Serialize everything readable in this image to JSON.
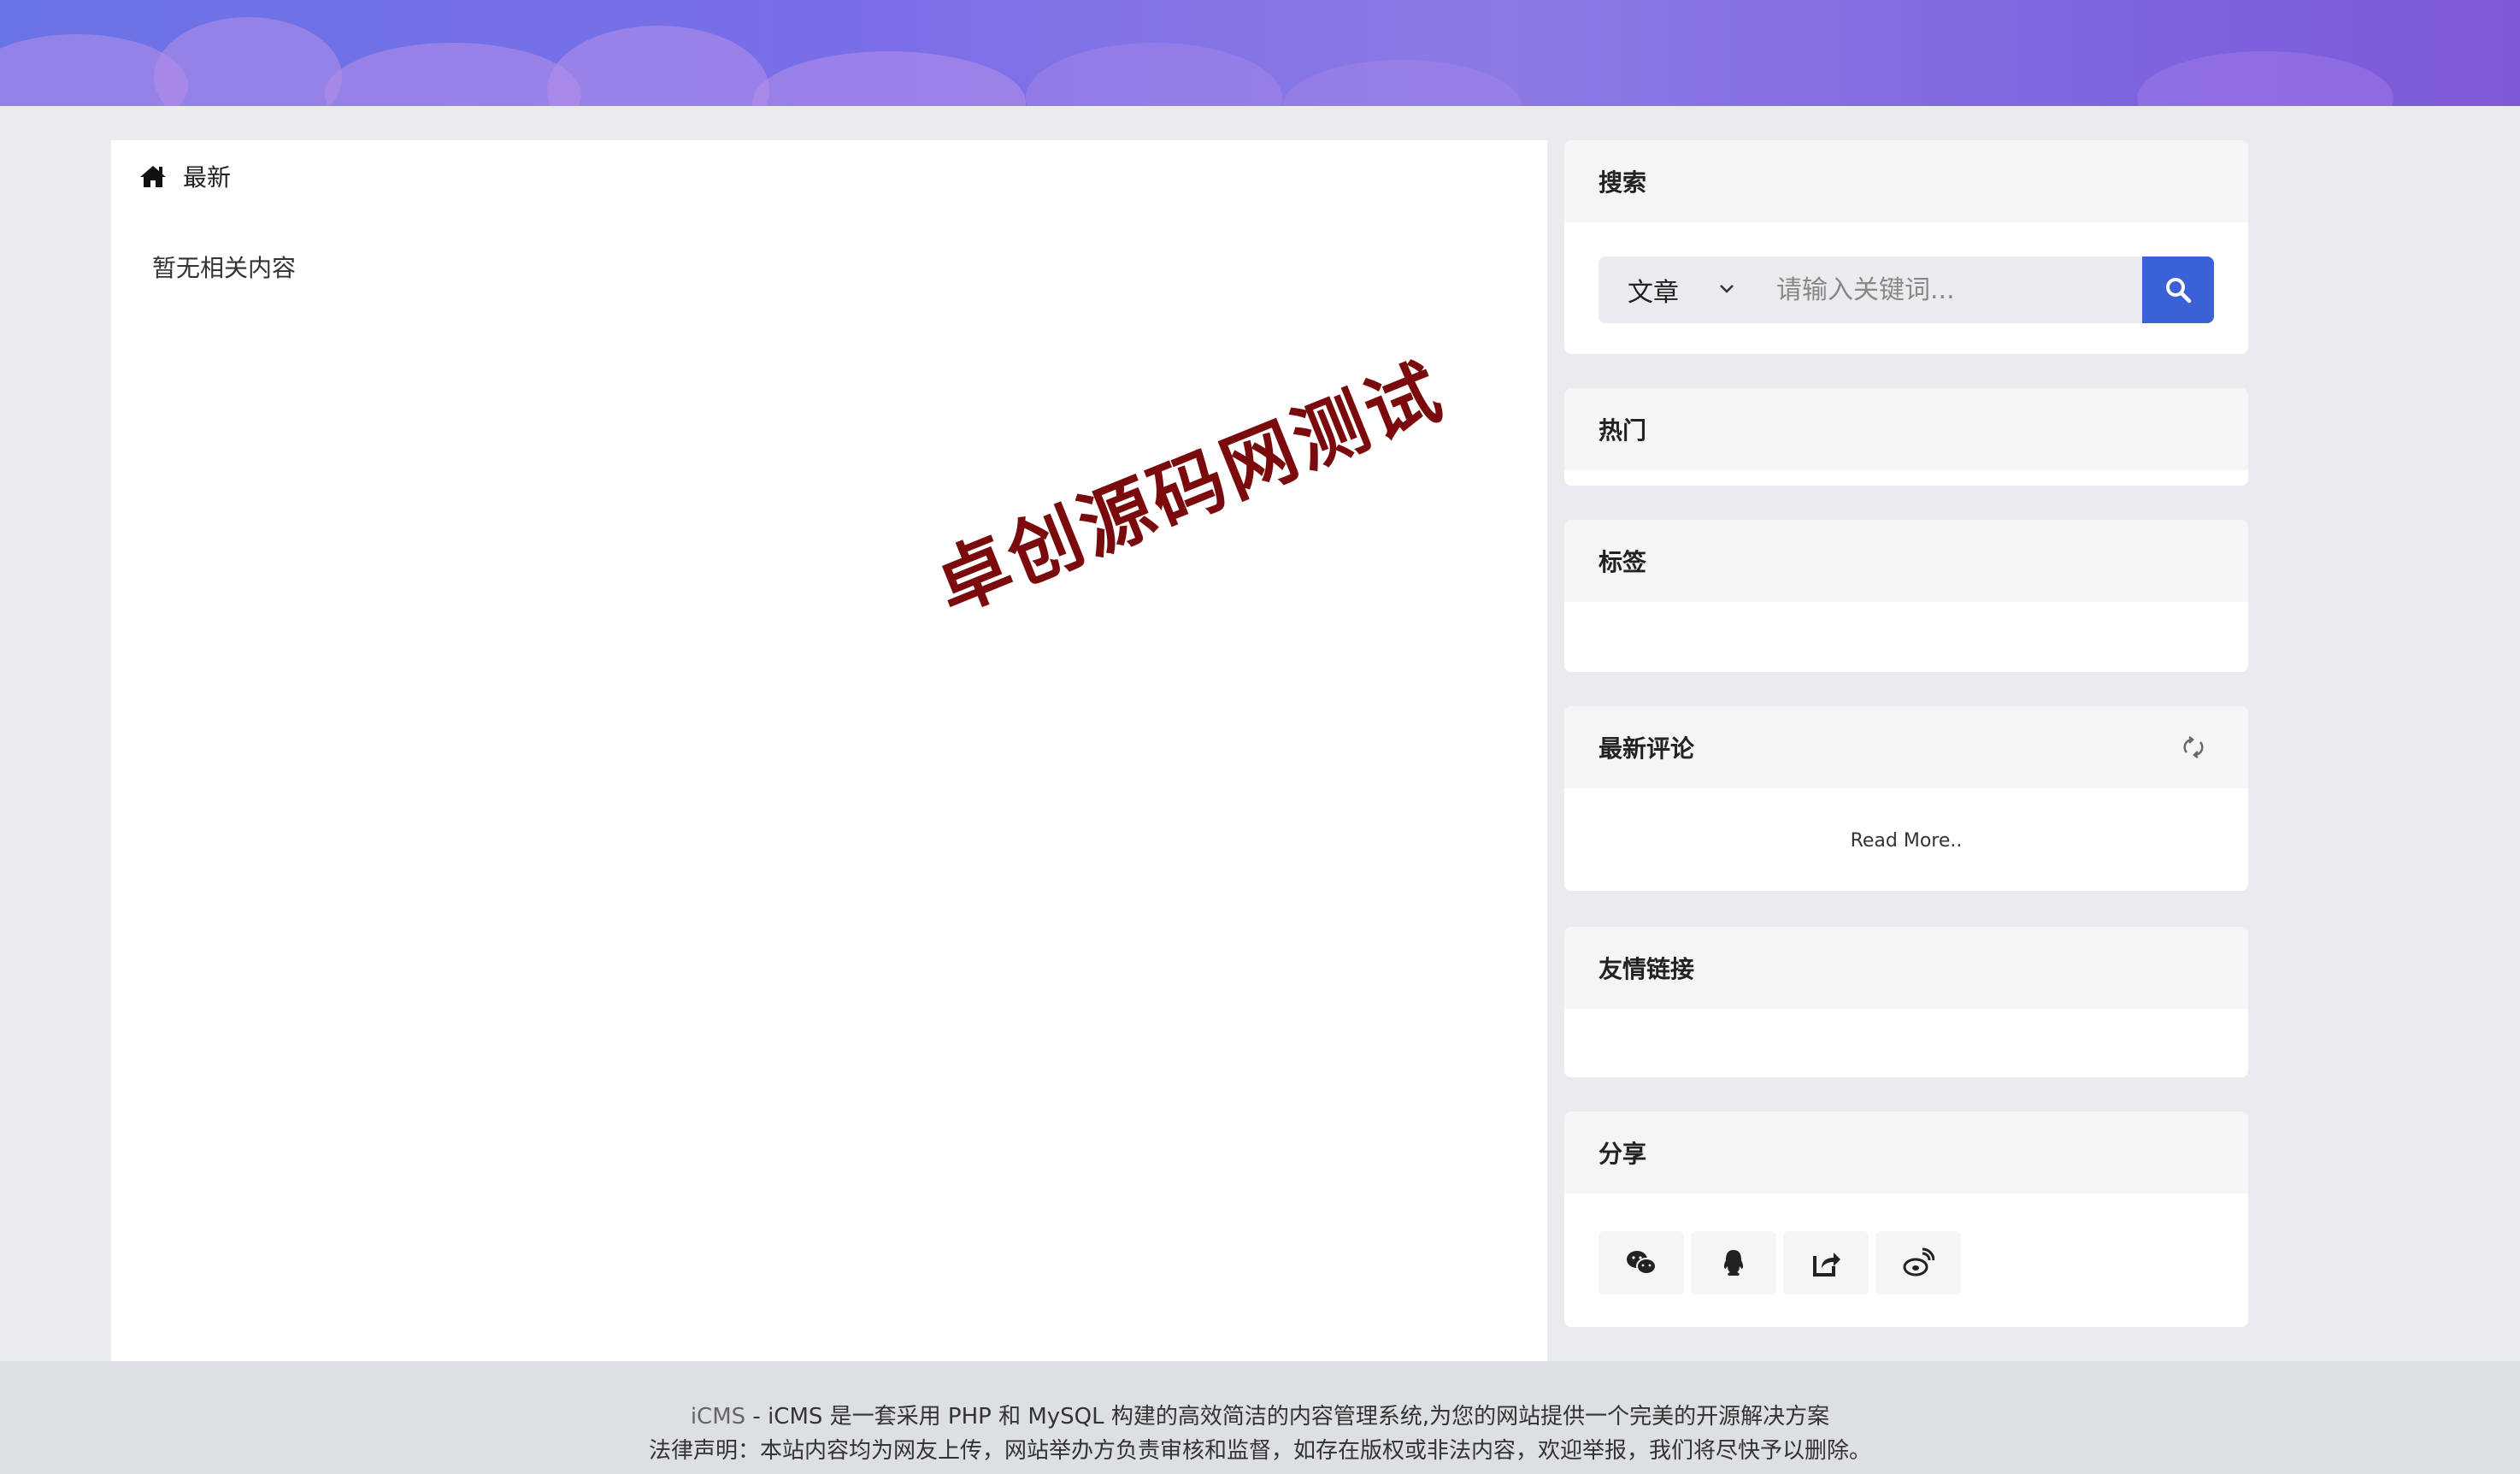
{
  "breadcrumb": {
    "label": "最新"
  },
  "main": {
    "empty_text": "暂无相关内容"
  },
  "watermark": "卓创源码网测试",
  "search": {
    "title": "搜索",
    "type_selected": "文章",
    "placeholder": "请输入关键词..."
  },
  "hot": {
    "title": "热门"
  },
  "tags": {
    "title": "标签"
  },
  "comments": {
    "title": "最新评论",
    "read_more": "Read More.."
  },
  "links": {
    "title": "友情链接"
  },
  "share": {
    "title": "分享",
    "icons": [
      "wechat-icon",
      "qq-icon",
      "share-icon",
      "weibo-icon"
    ]
  },
  "footer": {
    "brand": "iCMS",
    "tagline": " - iCMS 是一套采用 PHP 和 MySQL 构建的高效简洁的内容管理系统,为您的网站提供一个完美的开源解决方案",
    "legal": "法律声明：本站内容均为网友上传，网站举办方负责审核和监督，如存在版权或非法内容，欢迎举报，我们将尽快予以删除。"
  },
  "colors": {
    "accent": "#3a62d6",
    "watermark": "#7a0a0c",
    "page_bg": "#e9ebee",
    "banner": "#7b6ee8"
  }
}
